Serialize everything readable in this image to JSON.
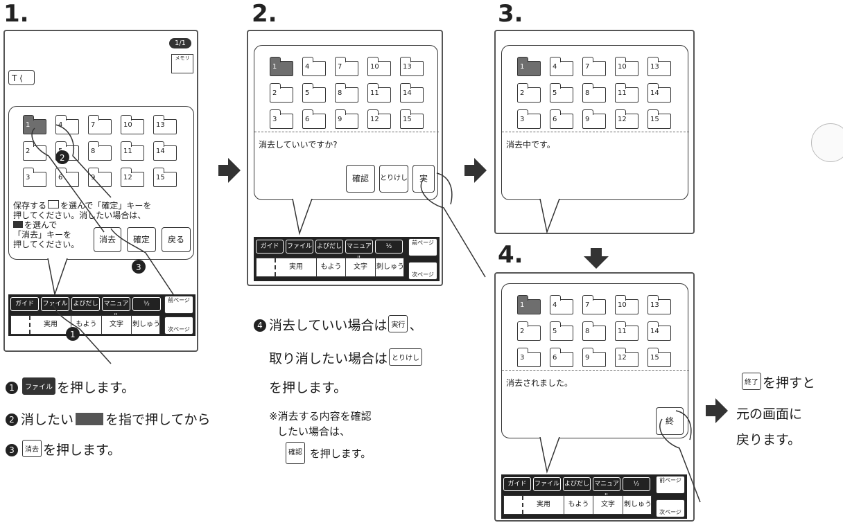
{
  "steps": {
    "s1": "1.",
    "s2": "2.",
    "s3": "3.",
    "s4": "4."
  },
  "screen1": {
    "page_badge": "1/1",
    "memory_label": "メモリ",
    "t_label": "T",
    "message": [
      "保存する",
      "を選んで「確定」キーを",
      "押してください。消したい場合は、",
      "を選んで",
      "「消去」キーを",
      "押してください。"
    ],
    "erase_label": "消去",
    "confirm_label": "確定",
    "back_label": "戻る"
  },
  "folders": [
    "1",
    "4",
    "7",
    "10",
    "13",
    "2",
    "5",
    "8",
    "11",
    "14",
    "3",
    "6",
    "9",
    "12",
    "15"
  ],
  "toolbar": {
    "guide": "ガイド",
    "file": "ファイル",
    "call": "よびだし",
    "manual": "マニュアル",
    "edit": "½",
    "prev_page": "前ページ",
    "next_page": "次ページ"
  },
  "bottom": {
    "practical": "実用",
    "pattern": "もよう",
    "text": "文字",
    "embroidery": "刺しゅう"
  },
  "screen2": {
    "message": "消去していいですか?",
    "check": "確認",
    "cancel": "とりけし",
    "exec": "実"
  },
  "screen3": {
    "message": "消去中です。"
  },
  "screen4": {
    "message": "消去されました。",
    "end": "終"
  },
  "instructions1": {
    "line1_num": "1",
    "line1_key": "ファイル",
    "line1_text": "を押します。",
    "line2_num": "2",
    "line2_a": "消したい",
    "line2_b": "を指で押してから",
    "line3_num": "3",
    "line3_key": "消去",
    "line3_text": "を押します。"
  },
  "instructions2": {
    "line1_num": "4",
    "line1_a": "消去していい場合は",
    "line1_key": "実行",
    "line1_b": "、",
    "line2_a": "取り消したい場合は",
    "line2_key": "とりけし",
    "line3": "を押します。",
    "note1": "※消去する内容を確認",
    "note2": "したい場合は、",
    "note_key": "確認",
    "note3": "を押します。"
  },
  "instructions3": {
    "key": "終了",
    "line1": "を押すと",
    "line2": "元の画面に",
    "line3": "戻ります。"
  }
}
